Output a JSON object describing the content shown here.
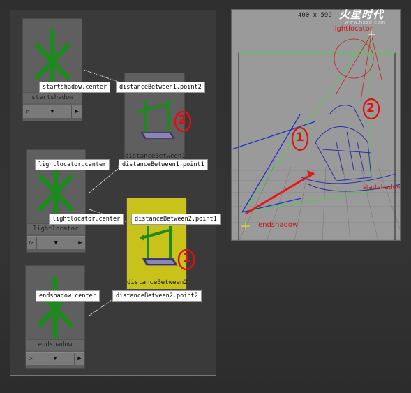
{
  "hypergraph": {
    "nodes": [
      {
        "caption": "startshadow"
      },
      {
        "caption": "distanceBetween1"
      },
      {
        "caption": "lightlocator"
      },
      {
        "caption": "distanceBetween2"
      },
      {
        "caption": "endshadow"
      }
    ],
    "labels": {
      "startshadow_center": "startshadow.center",
      "db1_point2": "distanceBetween1.point2",
      "lightlocator_center": "lightlocator.center",
      "db1_point1": "distanceBetween1.point1",
      "lightlocator_center2": "lightlocator.center",
      "db2_point1": "distanceBetween2.point1",
      "endshadow_center": "endshadow.center",
      "db2_point2": "distanceBetween2.point2"
    },
    "markers": {
      "node2": "2",
      "node1": "1"
    },
    "colors": {
      "locator": "#1c8a1c",
      "highlight": "#c9c21a",
      "marker": "#e01010"
    }
  },
  "viewport": {
    "resolution": "400 x 599",
    "labels": {
      "lightlocator": "lightlocator",
      "startshadow": "startshadow",
      "endshadow": "endshadow"
    },
    "markers": {
      "one": "1",
      "two": "2"
    }
  },
  "watermark": {
    "title": "火星时代",
    "sub": "www.hxsd.com"
  }
}
